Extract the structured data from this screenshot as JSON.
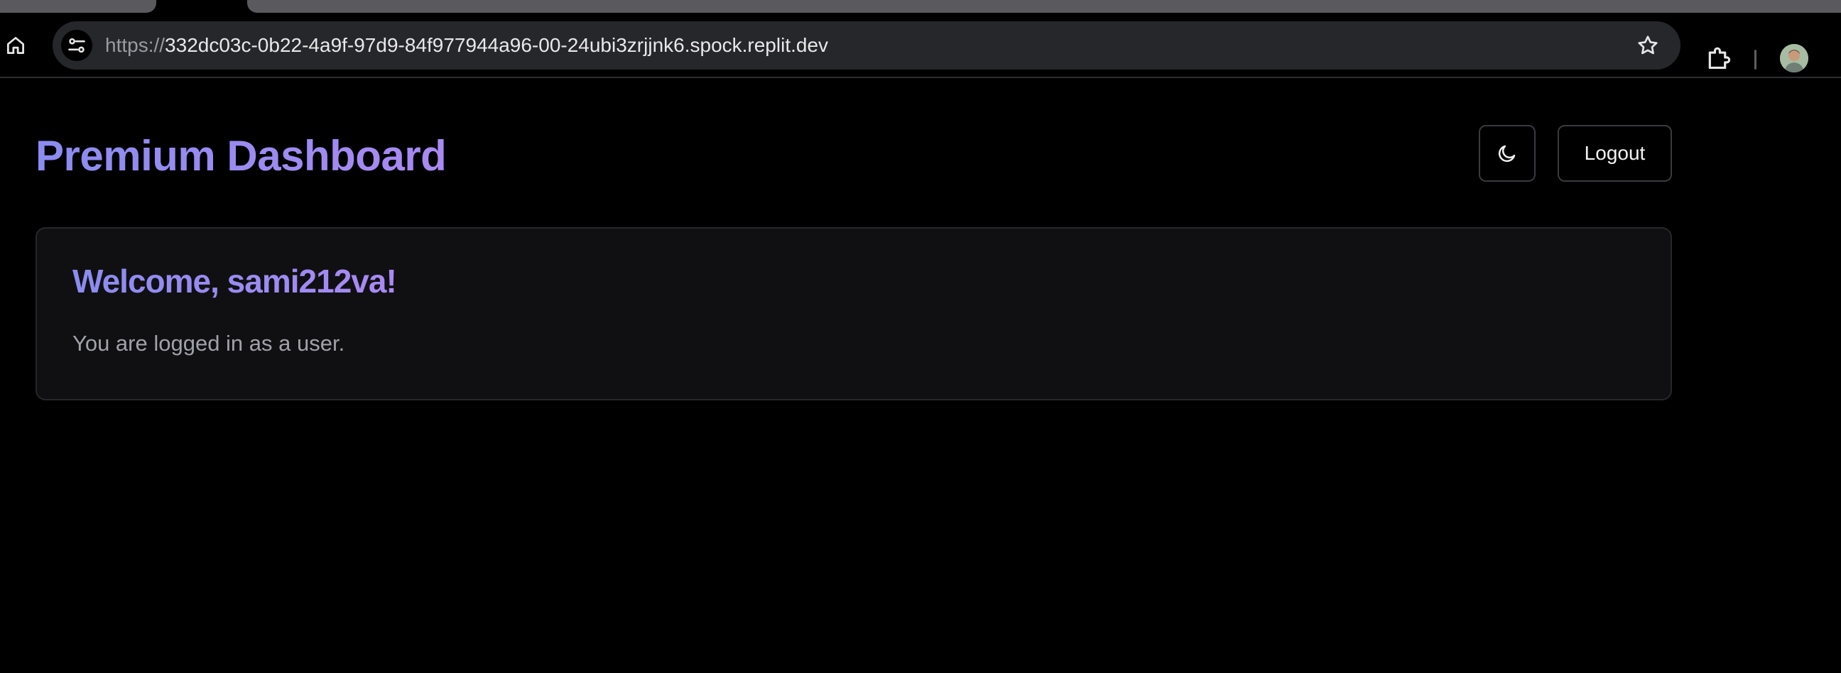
{
  "browser": {
    "url_scheme": "https://",
    "url_host": "332dc03c-0b22-4a9f-97d9-84f977944a96-00-24ubi3zrjjnk6.spock.replit.dev",
    "icons": {
      "home": "home-icon",
      "site_info": "tune-icon",
      "bookmark": "star-icon",
      "extensions": "puzzle-icon",
      "profile": "avatar"
    }
  },
  "header": {
    "title": "Premium Dashboard",
    "theme_toggle_icon": "moon-icon",
    "logout_label": "Logout"
  },
  "welcome": {
    "title": "Welcome, sami212va!",
    "message": "You are logged in as a user."
  },
  "colors": {
    "background": "#000000",
    "accent_start": "#8b8cf0",
    "accent_end": "#a98af2",
    "card_background": "#101013",
    "border": "#3a3a3f",
    "muted_text": "#a1a1aa"
  }
}
